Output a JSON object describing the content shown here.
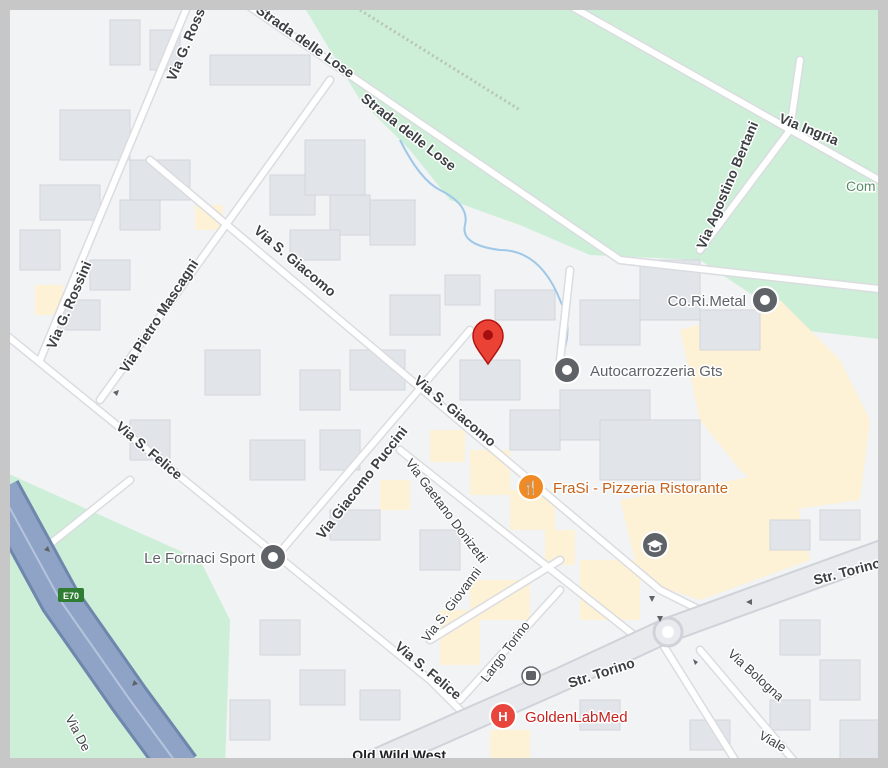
{
  "map": {
    "streets": {
      "via_g_rossini_top": "Via G. Rossini",
      "via_g_rossini_left": "Via G. Rossini",
      "strada_delle_lose_top": "Strada delle Lose",
      "strada_delle_lose": "Strada delle Lose",
      "via_ingria": "Via Ingria",
      "via_agostino_bertani": "Via Agostino Bertani",
      "via_s_giacomo_upper": "Via S. Giacomo",
      "via_s_giacomo_lower": "Via S. Giacomo",
      "via_pietro_mascagni": "Via Pietro Mascagni",
      "via_s_felice_upper": "Via S. Felice",
      "via_s_felice_lower": "Via S. Felice",
      "via_giacomo_puccini": "Via Giacomo Puccini",
      "via_gaetano_donizetti": "Via Gaetano Donizetti",
      "via_s_giovanni": "Via S. Giovanni",
      "largo_torino": "Largo Torino",
      "str_torino_right": "Str. Torino",
      "str_torino_lower": "Str. Torino",
      "via_bologna": "Via Bologna",
      "viale": "Viale",
      "via_de": "Via De",
      "com_edge": "Com"
    },
    "highway_shield": "E70",
    "pois": [
      {
        "name": "Co.Ri.Metal",
        "icon": "pin-circle-icon",
        "color": "#5f6368"
      },
      {
        "name": "Autocarrozzeria Gts",
        "icon": "pin-circle-icon",
        "color": "#5f6368"
      },
      {
        "name": "FraSi - Pizzeria Ristorante",
        "icon": "restaurant-icon",
        "color": "#f08a24"
      },
      {
        "name": "Le Fornaci Sport",
        "icon": "pin-circle-icon",
        "color": "#5f6368"
      },
      {
        "name": "GoldenLabMed",
        "icon": "hospital-icon",
        "color": "#e8453c"
      },
      {
        "name": "Old Wild West",
        "icon": "restaurant-icon",
        "color": "#f08a24"
      }
    ],
    "marker": {
      "icon": "location-pin-icon",
      "color": "#ea4335"
    },
    "colors": {
      "land": "#f1f3f4",
      "park": "#cdeed7",
      "road": "#dadce0",
      "road_outline": "#ffffff",
      "building": "#e1e4e8",
      "commercial": "#fdf1d6",
      "highway": "#8ea3c5",
      "frame": "#c7c7c7"
    }
  }
}
